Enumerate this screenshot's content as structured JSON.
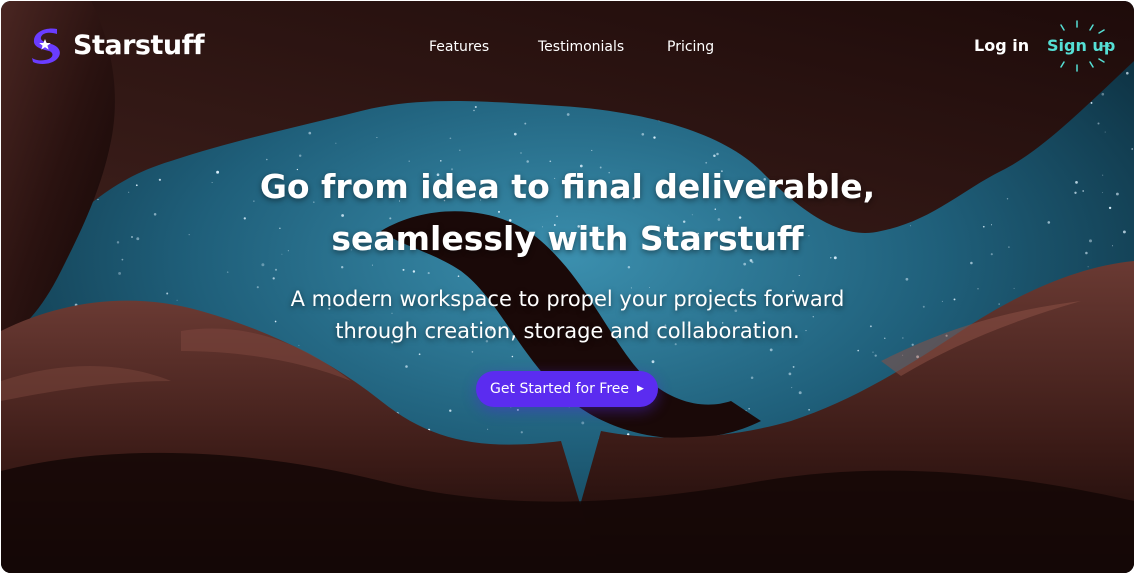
{
  "brand": {
    "name": "Starstuff",
    "logo_icon": "starstuff-logo-icon",
    "logo_color": "#6a3cff"
  },
  "nav": {
    "links": [
      {
        "label": "Features"
      },
      {
        "label": "Testimonials"
      },
      {
        "label": "Pricing"
      }
    ],
    "login_label": "Log in",
    "signup_label": "Sign up",
    "signup_color": "#55dfd5"
  },
  "hero": {
    "title_line1": "Go from idea to final deliverable,",
    "title_line2": "seamlessly with Starstuff",
    "subtitle_line1": "A modern workspace to propel your projects forward",
    "subtitle_line2": "through creation, storage and collaboration.",
    "cta_label": "Get Started for Free",
    "cta_icon": "play-arrow-icon",
    "cta_color": "#5b2cf0"
  },
  "background": {
    "description_icon": "canyon-night-sky-image",
    "sky_color": "#2a6f8c",
    "rock_color": "#3a1c18"
  }
}
